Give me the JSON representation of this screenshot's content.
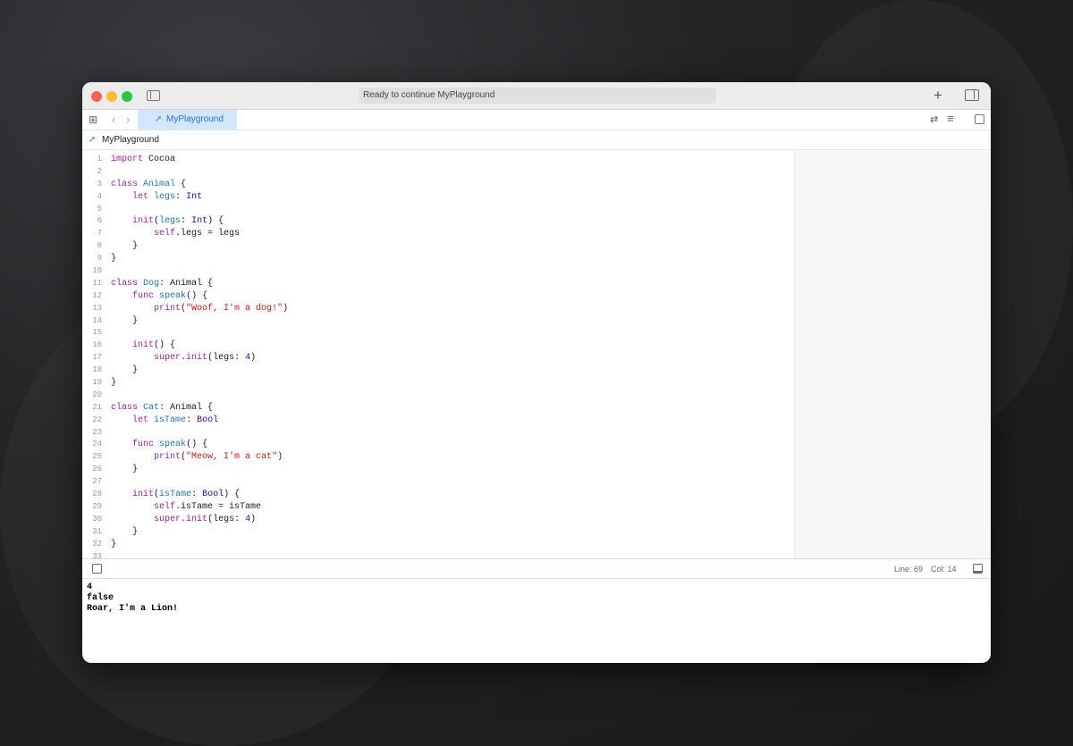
{
  "window": {
    "status": "Ready to continue MyPlayground"
  },
  "tab": {
    "label": "MyPlayground"
  },
  "jumpbar": {
    "label": "MyPlayground"
  },
  "colors": {
    "keyword": "#9b2393",
    "declaration": "#1f7a9c",
    "type": "#3900a0",
    "string": "#c41a16",
    "number": "#1c00cf",
    "function": "#6c36a9",
    "tab_bg": "#d3e6fa"
  },
  "code": [
    [
      [
        "k",
        "import"
      ],
      [
        "p",
        " Cocoa"
      ]
    ],
    [],
    [
      [
        "k",
        "class"
      ],
      [
        "p",
        " "
      ],
      [
        "d",
        "Animal"
      ],
      [
        "p",
        " {"
      ]
    ],
    [
      [
        "p",
        "    "
      ],
      [
        "k",
        "let"
      ],
      [
        "p",
        " "
      ],
      [
        "d",
        "legs"
      ],
      [
        "p",
        ": "
      ],
      [
        "t",
        "Int"
      ]
    ],
    [],
    [
      [
        "p",
        "    "
      ],
      [
        "k",
        "init"
      ],
      [
        "p",
        "("
      ],
      [
        "d",
        "legs"
      ],
      [
        "p",
        ": "
      ],
      [
        "t",
        "Int"
      ],
      [
        "p",
        ") {"
      ]
    ],
    [
      [
        "p",
        "        "
      ],
      [
        "k",
        "self"
      ],
      [
        "p",
        ".legs = legs"
      ]
    ],
    [
      [
        "p",
        "    }"
      ]
    ],
    [
      [
        "p",
        "}"
      ]
    ],
    [],
    [
      [
        "k",
        "class"
      ],
      [
        "p",
        " "
      ],
      [
        "d",
        "Dog"
      ],
      [
        "p",
        ": Animal {"
      ]
    ],
    [
      [
        "p",
        "    "
      ],
      [
        "k",
        "func"
      ],
      [
        "p",
        " "
      ],
      [
        "d",
        "speak"
      ],
      [
        "p",
        "() {"
      ]
    ],
    [
      [
        "p",
        "        "
      ],
      [
        "f",
        "print"
      ],
      [
        "p",
        "("
      ],
      [
        "s",
        "\"Woof, I'm a dog!\""
      ],
      [
        "p",
        ")"
      ]
    ],
    [
      [
        "p",
        "    }"
      ]
    ],
    [],
    [
      [
        "p",
        "    "
      ],
      [
        "k",
        "init"
      ],
      [
        "p",
        "() {"
      ]
    ],
    [
      [
        "p",
        "        "
      ],
      [
        "k",
        "super"
      ],
      [
        "p",
        "."
      ],
      [
        "k",
        "init"
      ],
      [
        "p",
        "(legs: "
      ],
      [
        "n",
        "4"
      ],
      [
        "p",
        ")"
      ]
    ],
    [
      [
        "p",
        "    }"
      ]
    ],
    [
      [
        "p",
        "}"
      ]
    ],
    [],
    [
      [
        "k",
        "class"
      ],
      [
        "p",
        " "
      ],
      [
        "d",
        "Cat"
      ],
      [
        "p",
        ": Animal {"
      ]
    ],
    [
      [
        "p",
        "    "
      ],
      [
        "k",
        "let"
      ],
      [
        "p",
        " "
      ],
      [
        "d",
        "isTame"
      ],
      [
        "p",
        ": "
      ],
      [
        "t",
        "Bool"
      ]
    ],
    [],
    [
      [
        "p",
        "    "
      ],
      [
        "k",
        "func"
      ],
      [
        "p",
        " "
      ],
      [
        "d",
        "speak"
      ],
      [
        "p",
        "() {"
      ]
    ],
    [
      [
        "p",
        "        "
      ],
      [
        "f",
        "print"
      ],
      [
        "p",
        "("
      ],
      [
        "s",
        "\"Meow, I'm a cat\""
      ],
      [
        "p",
        ")"
      ]
    ],
    [
      [
        "p",
        "    }"
      ]
    ],
    [],
    [
      [
        "p",
        "    "
      ],
      [
        "k",
        "init"
      ],
      [
        "p",
        "("
      ],
      [
        "d",
        "isTame"
      ],
      [
        "p",
        ": "
      ],
      [
        "t",
        "Bool"
      ],
      [
        "p",
        ") {"
      ]
    ],
    [
      [
        "p",
        "        "
      ],
      [
        "k",
        "self"
      ],
      [
        "p",
        ".isTame = isTame"
      ]
    ],
    [
      [
        "p",
        "        "
      ],
      [
        "k",
        "super"
      ],
      [
        "p",
        "."
      ],
      [
        "k",
        "init"
      ],
      [
        "p",
        "(legs: "
      ],
      [
        "n",
        "4"
      ],
      [
        "p",
        ")"
      ]
    ],
    [
      [
        "p",
        "    }"
      ]
    ],
    [
      [
        "p",
        "}"
      ]
    ],
    []
  ],
  "statusbar": {
    "line": "Line: 69",
    "col": "Col: 14"
  },
  "console": [
    "4",
    "false",
    "Roar, I'm a Lion!"
  ]
}
